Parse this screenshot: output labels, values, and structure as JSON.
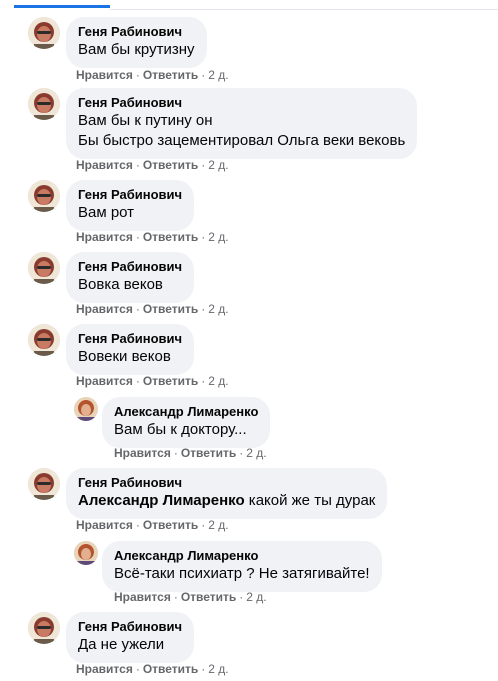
{
  "comments": [
    {
      "author": "Геня Рабинович",
      "lines": [
        "Вам бы крутизну"
      ],
      "like": "Нравится",
      "reply": "Ответить",
      "time": "2 д."
    },
    {
      "author": "Геня Рабинович",
      "lines": [
        "Вам бы к путину он",
        "Бы быстро зацементировал Ольга веки вековь"
      ],
      "like": "Нравится",
      "reply": "Ответить",
      "time": "2 д."
    },
    {
      "author": "Геня Рабинович",
      "lines": [
        "Вам рот"
      ],
      "like": "Нравится",
      "reply": "Ответить",
      "time": "2 д."
    },
    {
      "author": "Геня Рабинович",
      "lines": [
        "Вовка веков"
      ],
      "like": "Нравится",
      "reply": "Ответить",
      "time": "2 д."
    },
    {
      "author": "Геня Рабинович",
      "lines": [
        "Вовеки веков"
      ],
      "like": "Нравится",
      "reply": "Ответить",
      "time": "2 д."
    },
    {
      "author": "Александр Лимаренко",
      "lines": [
        "Вам бы к доктору..."
      ],
      "like": "Нравится",
      "reply": "Ответить",
      "time": "2 д."
    },
    {
      "author": "Геня Рабинович",
      "mention": "Александр Лимаренко",
      "lines": [
        "какой же ты дурак"
      ],
      "like": "Нравится",
      "reply": "Ответить",
      "time": "2 д."
    },
    {
      "author": "Александр Лимаренко",
      "lines": [
        "Всё-таки психиатр ? Не затягивайте!"
      ],
      "like": "Нравится",
      "reply": "Ответить",
      "time": "2 д."
    },
    {
      "author": "Геня Рабинович",
      "lines": [
        "Да не ужели"
      ],
      "like": "Нравится",
      "reply": "Ответить",
      "time": "2 д."
    }
  ],
  "separator": "·",
  "icons": {
    "avatar_a": "avatar-icon",
    "avatar_b": "avatar-icon"
  },
  "colors": {
    "bubble": "#f0f2f5",
    "meta": "#65676b",
    "accent": "#1b74e4"
  }
}
